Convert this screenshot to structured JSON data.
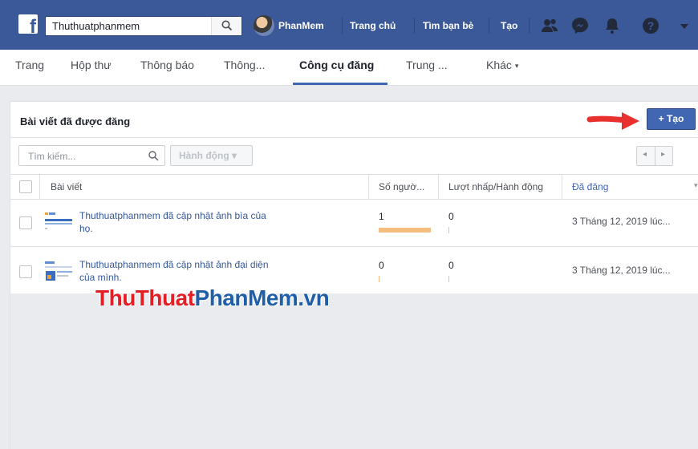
{
  "colors": {
    "brand": "#3b5998",
    "accent": "#4267b2",
    "link": "#365899",
    "arrow": "#e8302e",
    "reach_bar": "#f5be7e"
  },
  "topbar": {
    "search_value": "Thuthuatphanmem",
    "profile_name": "PhanMem",
    "links": [
      "Trang chủ",
      "Tìm bạn bè",
      "Tạo"
    ],
    "icons": [
      "friends-icon",
      "messenger-icon",
      "bell-icon",
      "help-icon",
      "caret-down-icon"
    ]
  },
  "subnav": {
    "tabs": [
      "Trang",
      "Hộp thư",
      "Thông báo",
      "Thông...",
      "Công cụ đăng",
      "Trung ...",
      "Khác"
    ],
    "more_caret": "▾",
    "active": "Công cụ đăng"
  },
  "panel": {
    "title": "Bài viết đã được đăng",
    "create_label": "+ Tạo",
    "search_placeholder": "Tìm kiếm...",
    "action_label": "Hành động ▾",
    "pager_prev": "◂",
    "pager_next": "▸"
  },
  "table": {
    "columns": [
      "Bài viết",
      "Số ngườ...",
      "Lượt nhấp/Hành động",
      "Đã đăng"
    ],
    "sorted_column": "Đã đăng",
    "rows": [
      {
        "post": "Thuthuatphanmem đã cập nhật ảnh bìa của họ.",
        "reach": "1",
        "reach_fill": 1.0,
        "clicks": "0",
        "published": "3 Tháng 12, 2019 lúc..."
      },
      {
        "post": "Thuthuatphanmem đã cập nhật ảnh đại diện của mình.",
        "reach": "0",
        "reach_fill": 0.0,
        "clicks": "0",
        "published": "3 Tháng 12, 2019 lúc..."
      }
    ]
  },
  "watermark": {
    "part1": "ThuThuat",
    "part2": "PhanMem.vn"
  }
}
